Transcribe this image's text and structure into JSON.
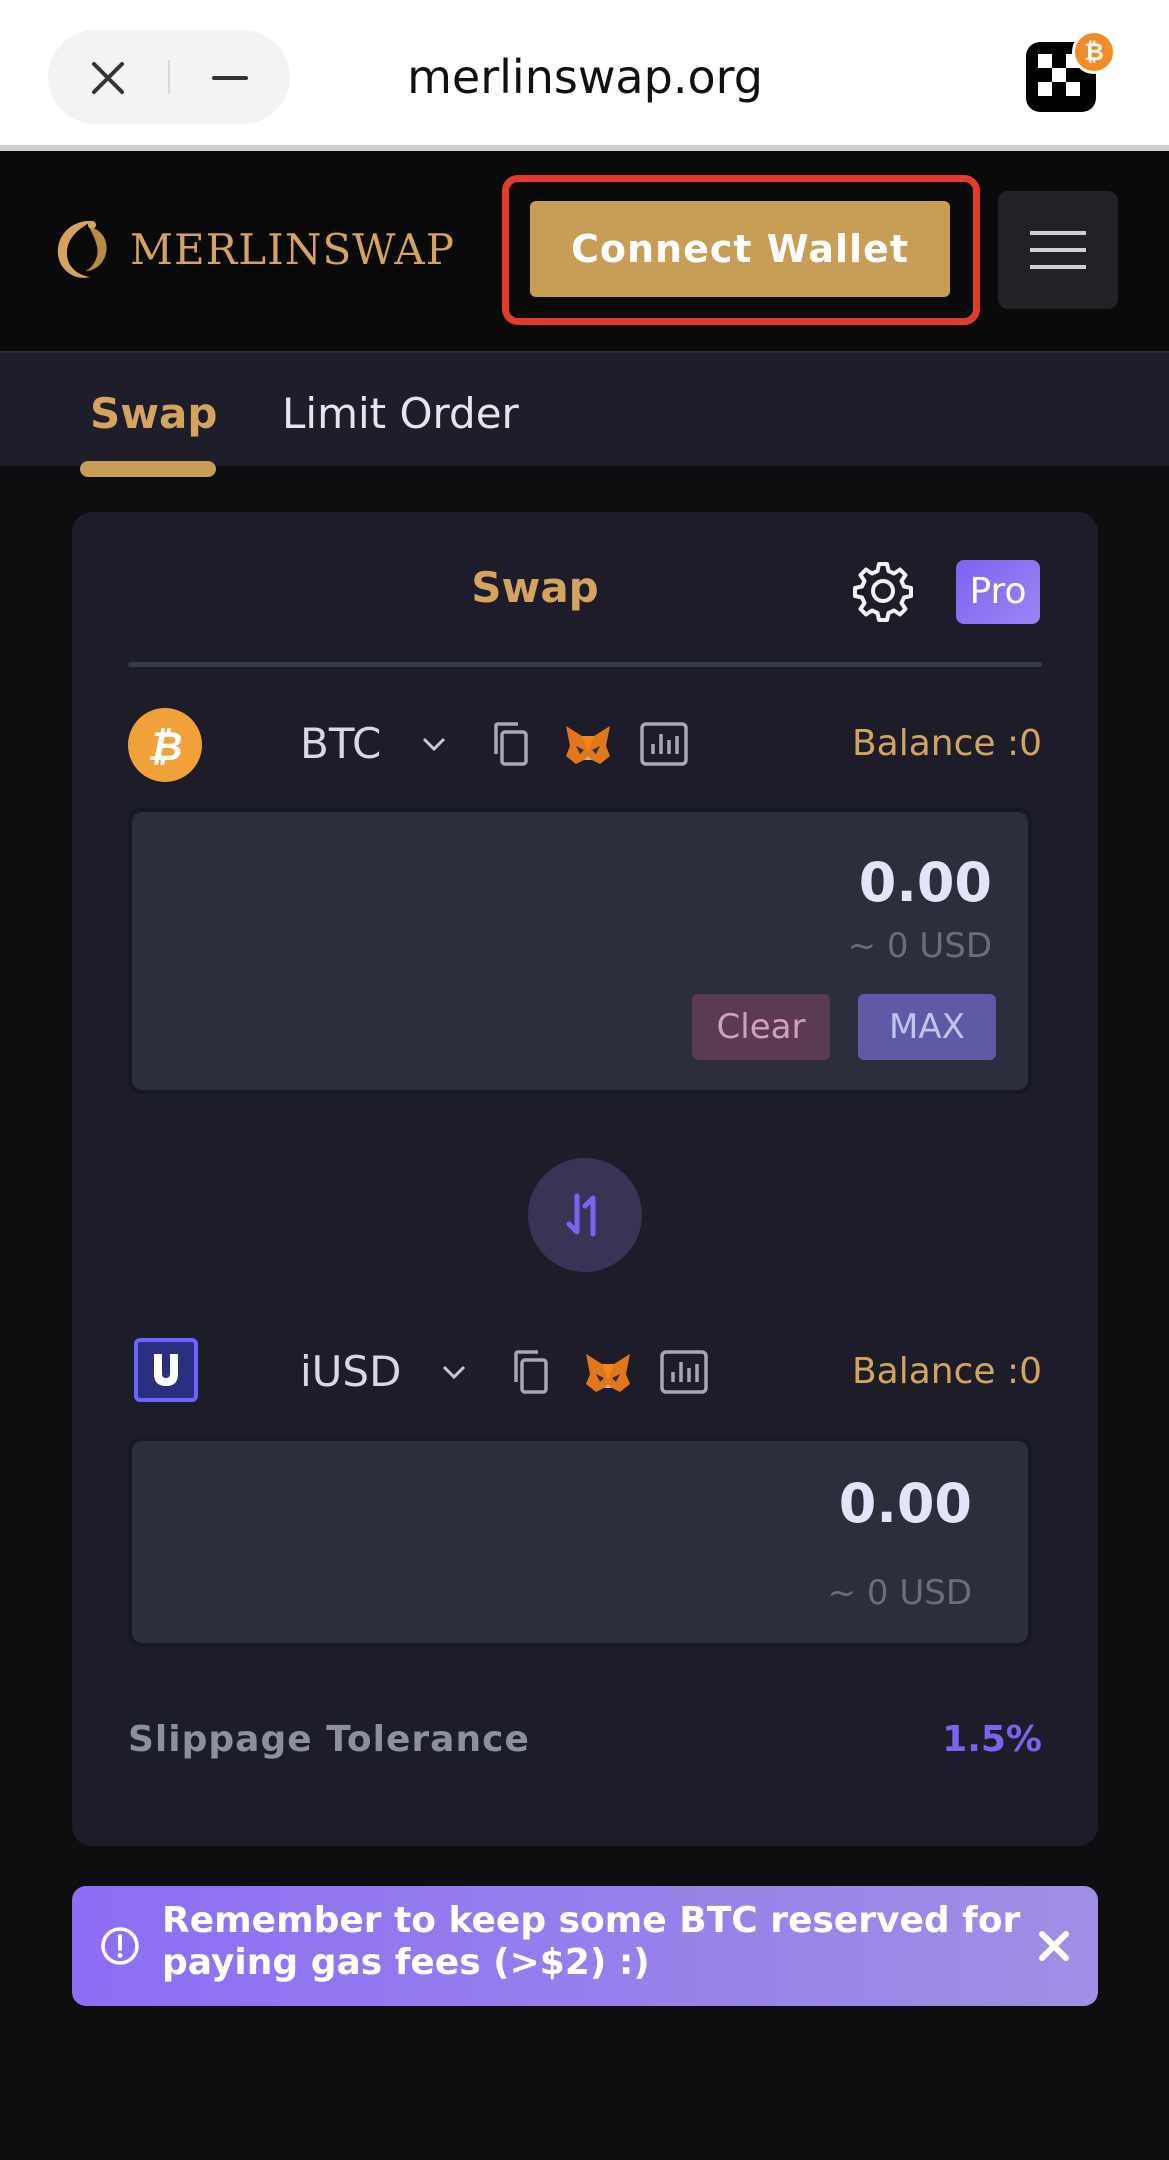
{
  "browser": {
    "url": "merlinswap.org",
    "close_icon": "close-icon",
    "minimize_icon": "minimize-icon",
    "extension_icon": "okx-extension-icon",
    "extension_badge": "₿"
  },
  "header": {
    "logo_text": "MERLINSWAP",
    "connect_wallet_label": "Connect Wallet",
    "menu_icon": "hamburger-menu-icon"
  },
  "tabs": [
    {
      "label": "Swap",
      "active": true
    },
    {
      "label": "Limit Order",
      "active": false
    }
  ],
  "swap_card": {
    "title": "Swap",
    "settings_icon": "gear-icon",
    "pro_label": "Pro",
    "from": {
      "token": "BTC",
      "balance": "Balance :0",
      "amount": "0.00",
      "usd": "~ 0 USD",
      "clear_label": "Clear",
      "max_label": "MAX"
    },
    "to": {
      "token": "iUSD",
      "balance": "Balance :0",
      "amount": "0.00",
      "usd": "~ 0 USD"
    },
    "slippage_label": "Slippage Tolerance",
    "slippage_value": "1.5%"
  },
  "notice": {
    "text": "Remember to keep some BTC reserved for paying gas fees (>$2) :)"
  },
  "colors": {
    "accent_gold": "#c89d55",
    "accent_purple": "#7d62f0",
    "highlight_red": "#e23b2e",
    "background": "#0e0e11",
    "card": "#1c1d28"
  }
}
